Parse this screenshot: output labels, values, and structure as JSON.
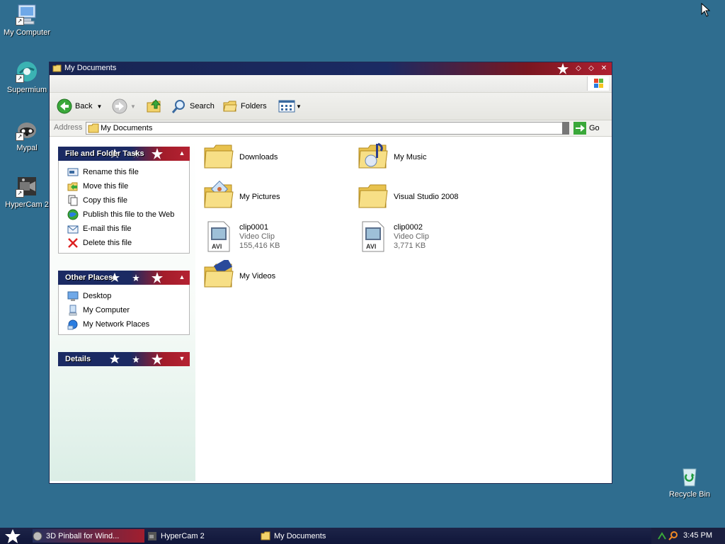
{
  "desktop": {
    "icons": [
      {
        "label": "My Computer"
      },
      {
        "label": "Supermium"
      },
      {
        "label": "Mypal"
      },
      {
        "label": "HyperCam 2"
      },
      {
        "label": "Recycle Bin"
      }
    ]
  },
  "window": {
    "title": "My Documents",
    "toolbar": {
      "back_label": "Back",
      "search_label": "Search",
      "folders_label": "Folders"
    },
    "address": {
      "label": "Address",
      "value": "My Documents",
      "go_label": "Go"
    },
    "taskpane": {
      "file_tasks": {
        "title": "File and Folder Tasks",
        "items": [
          {
            "label": "Rename this file"
          },
          {
            "label": "Move this file"
          },
          {
            "label": "Copy this file"
          },
          {
            "label": "Publish this file to the Web"
          },
          {
            "label": "E-mail this file"
          },
          {
            "label": "Delete this file"
          }
        ]
      },
      "other_places": {
        "title": "Other Places",
        "items": [
          {
            "label": "Desktop"
          },
          {
            "label": "My Computer"
          },
          {
            "label": "My Network Places"
          }
        ]
      },
      "details": {
        "title": "Details"
      }
    },
    "items": [
      {
        "name": "Downloads"
      },
      {
        "name": "My Music"
      },
      {
        "name": "My Pictures"
      },
      {
        "name": "Visual Studio 2008"
      },
      {
        "name": "clip0001",
        "type": "Video Clip",
        "size": "155,416 KB"
      },
      {
        "name": "clip0002",
        "type": "Video Clip",
        "size": "3,771 KB"
      },
      {
        "name": "My Videos"
      }
    ]
  },
  "taskbar": {
    "buttons": [
      {
        "label": "3D Pinball for Wind..."
      },
      {
        "label": "HyperCam 2"
      },
      {
        "label": "My Documents"
      }
    ],
    "clock": "3:45 PM"
  },
  "colors": {
    "desktop": "#2f6d8f",
    "navy": "#1b2a63",
    "red": "#b02030"
  }
}
